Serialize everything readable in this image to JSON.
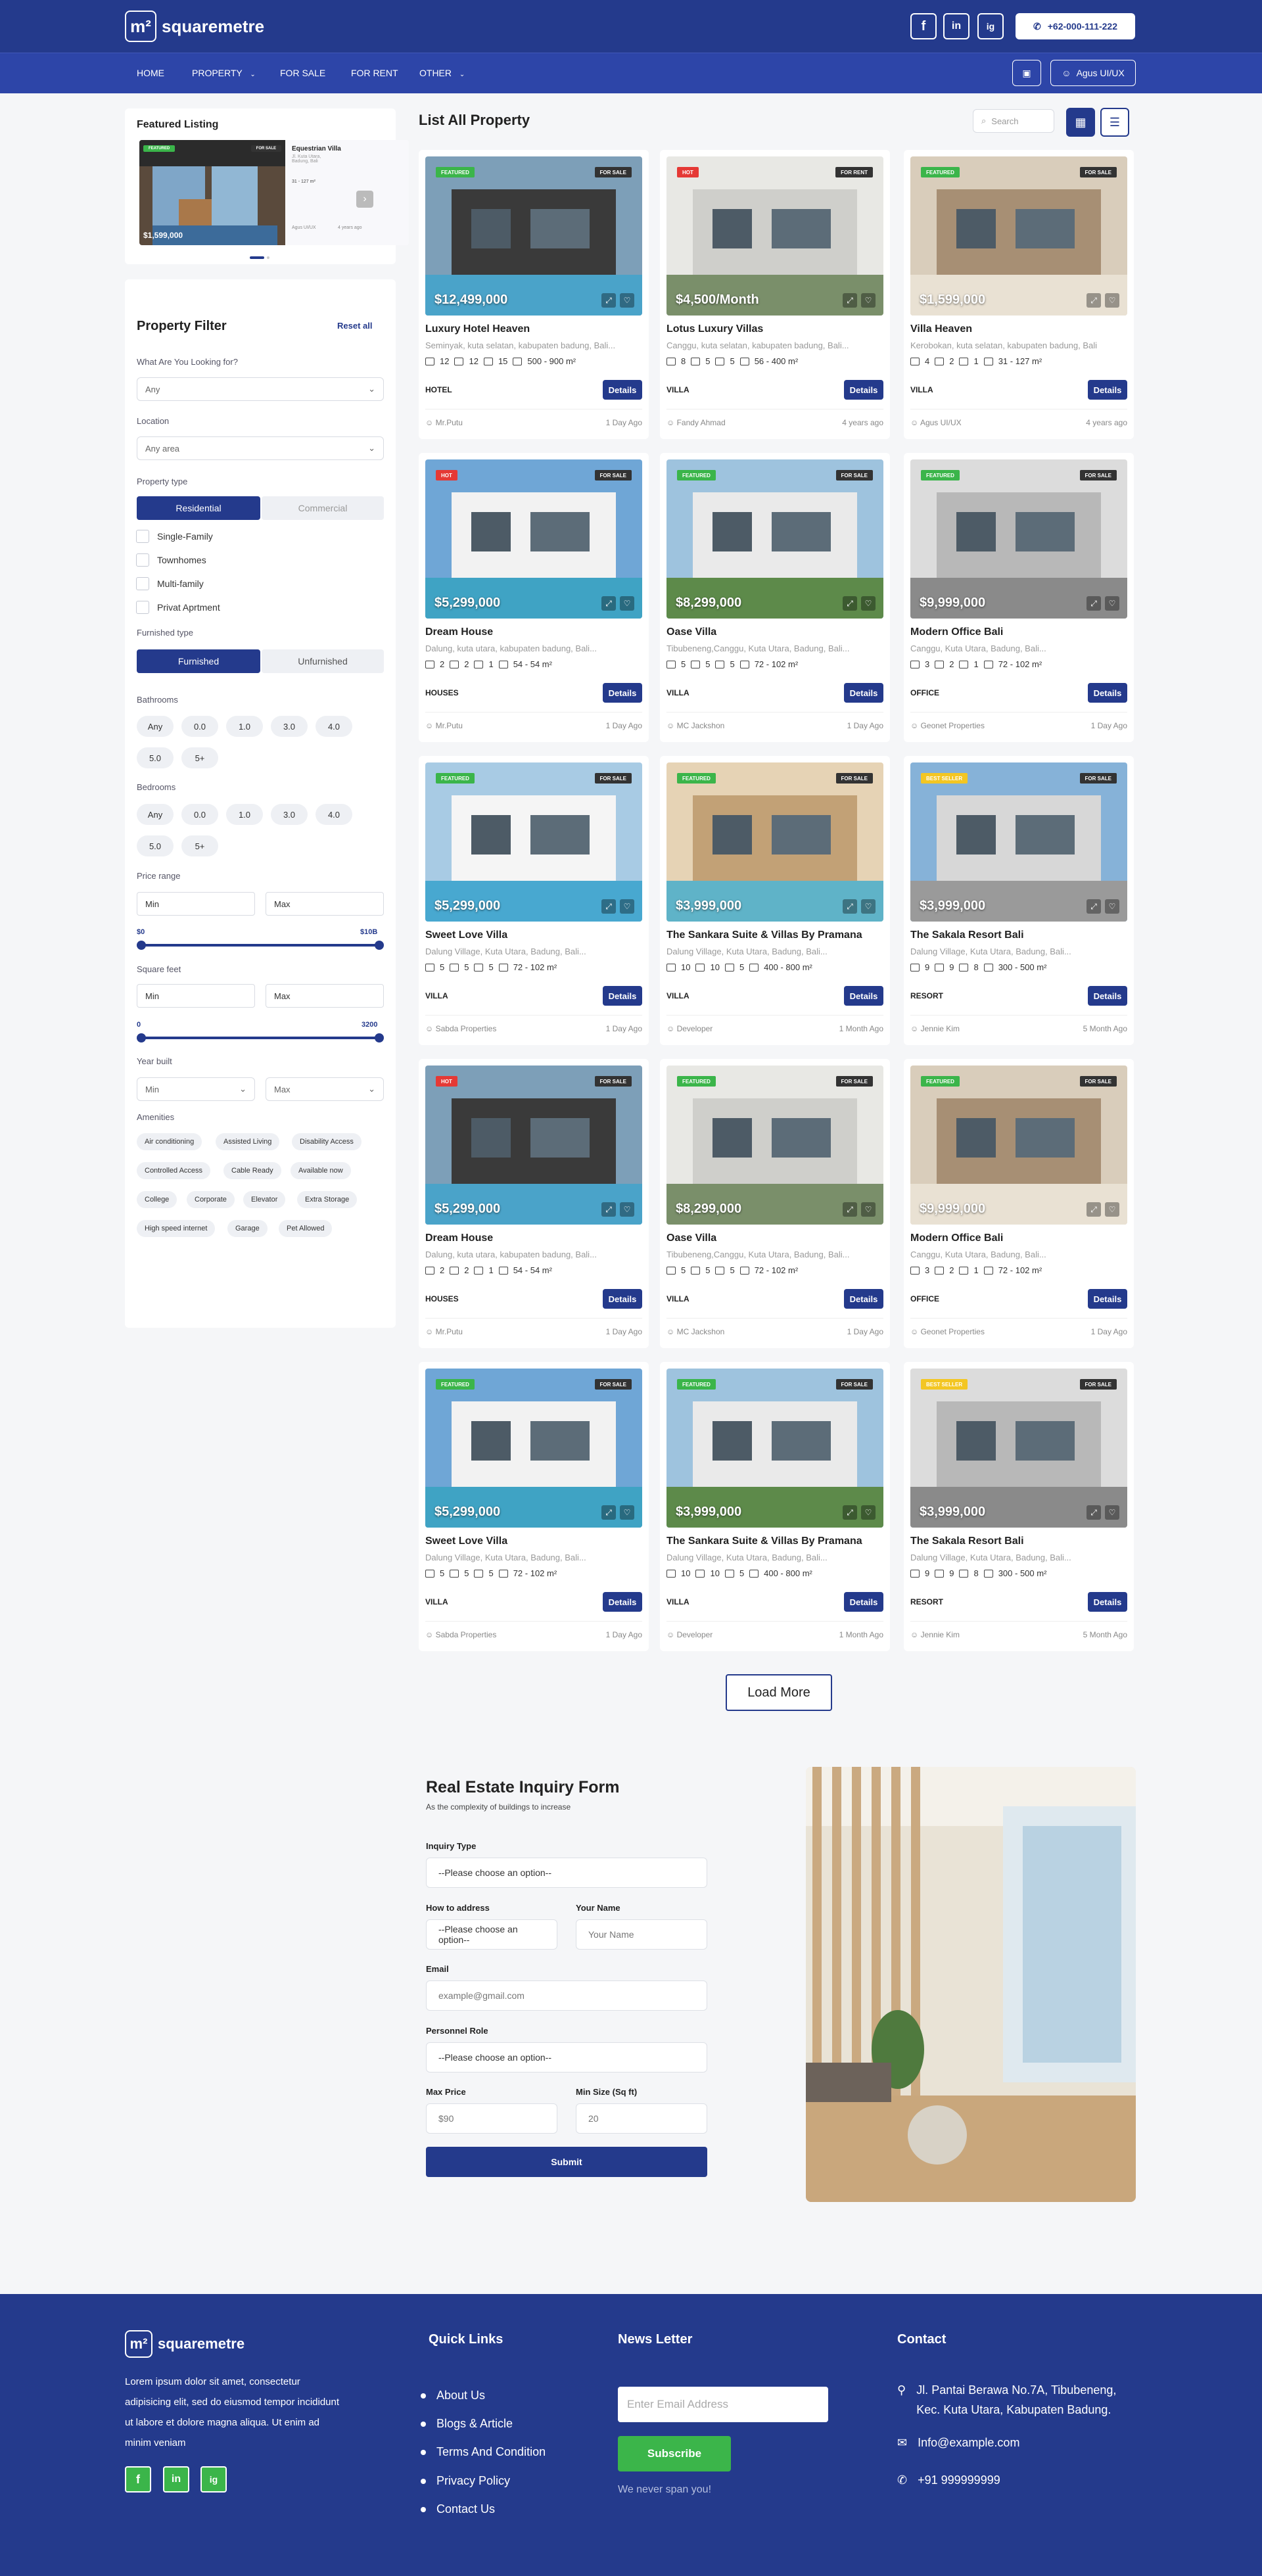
{
  "brand": {
    "name": "squaremetre",
    "mark": "m²"
  },
  "header": {
    "social": [
      "f",
      "in",
      "ig"
    ],
    "phone": "+62-000-111-222"
  },
  "nav": {
    "items": [
      "HOME",
      "PROPERTY",
      "FOR SALE",
      "FOR RENT",
      "OTHER"
    ],
    "user": "Agus UI/UX"
  },
  "featured": {
    "title": "Featured Listing",
    "name": "Equestrian Villa",
    "addr": "Jl. Kuta Utara, Badung, Bali",
    "price": "$1,599,000",
    "size": "31 - 127 m²",
    "agent": "Agus UI/UX",
    "time": "4 years ago",
    "badge": "FEATURED",
    "status": "FOR SALE"
  },
  "filter": {
    "title": "Property Filter",
    "reset": "Reset all",
    "looking_label": "What Are You Looking for?",
    "looking_value": "Any",
    "location_label": "Location",
    "location_value": "Any area",
    "ptype_label": "Property type",
    "ptype_options": [
      "Residential",
      "Commercial"
    ],
    "checks": [
      "Single-Family",
      "Townhomes",
      "Multi-family",
      "Privat Aprtment"
    ],
    "furnished_label": "Furnished type",
    "furnished_options": [
      "Furnished",
      "Unfurnished"
    ],
    "bathrooms_label": "Bathrooms",
    "bedrooms_label": "Bedrooms",
    "counts": [
      "Any",
      "0.0",
      "1.0",
      "3.0",
      "4.0",
      "5.0",
      "5+"
    ],
    "price_label": "Price range",
    "price_min": "Min",
    "price_max": "Max",
    "price_lo": "$0",
    "price_hi": "$10B",
    "sqft_label": "Square feet",
    "sqft_lo": "0",
    "sqft_hi": "3200",
    "year_label": "Year built",
    "year_min": "Min",
    "year_max": "Max",
    "amenities_label": "Amenities",
    "amenities": [
      "Air conditioning",
      "Assisted Living",
      "Disability Access",
      "Controlled Access",
      "Cable Ready",
      "Available now",
      "College",
      "Corporate",
      "Elevator",
      "Extra Storage",
      "High speed internet",
      "Garage",
      "Pet Allowed"
    ]
  },
  "listing": {
    "title": "List All Property",
    "search_placeholder": "Search",
    "load_more": "Load More",
    "details_label": "Details",
    "properties": [
      {
        "name": "Luxury Hotel Heaven",
        "addr": "Seminyak, kuta selatan, kabupaten badung, Bali...",
        "price": "$12,499,000",
        "badge": "FEATURED",
        "status": "FOR SALE",
        "type": "HOTEL",
        "f1": "12",
        "f2": "12",
        "f3": "15",
        "size": "500 - 900 m²",
        "agent": "Mr.Putu",
        "time": "1 Day Ago",
        "color": "#3bb54a"
      },
      {
        "name": "Lotus Luxury Villas",
        "addr": "Canggu, kuta selatan, kabupaten badung, Bali...",
        "price": "$4,500/Month",
        "badge": "HOT",
        "status": "FOR RENT",
        "type": "VILLA",
        "f1": "8",
        "f2": "5",
        "f3": "5",
        "size": "56 - 400 m²",
        "agent": "Fandy Ahmad",
        "time": "4 years ago",
        "color": "#e53935"
      },
      {
        "name": "Villa Heaven",
        "addr": "Kerobokan, kuta selatan, kabupaten badung, Bali",
        "price": "$1,599,000",
        "badge": "FEATURED",
        "status": "FOR SALE",
        "type": "VILLA",
        "f1": "4",
        "f2": "2",
        "f3": "1",
        "size": "31 - 127 m²",
        "agent": "Agus UI/UX",
        "time": "4 years ago",
        "color": "#3bb54a"
      },
      {
        "name": "Dream House",
        "addr": "Dalung, kuta utara, kabupaten badung, Bali...",
        "price": "$5,299,000",
        "badge": "HOT",
        "status": "FOR SALE",
        "type": "HOUSES",
        "f1": "2",
        "f2": "2",
        "f3": "1",
        "size": "54 - 54 m²",
        "agent": "Mr.Putu",
        "time": "1 Day Ago",
        "color": "#e53935"
      },
      {
        "name": "Oase Villa",
        "addr": "Tibubeneng,Canggu, Kuta Utara, Badung, Bali...",
        "price": "$8,299,000",
        "badge": "FEATURED",
        "status": "FOR SALE",
        "type": "VILLA",
        "f1": "5",
        "f2": "5",
        "f3": "5",
        "size": "72 - 102 m²",
        "agent": "MC Jackshon",
        "time": "1 Day Ago",
        "color": "#3bb54a"
      },
      {
        "name": "Modern Office Bali",
        "addr": "Canggu, Kuta Utara, Badung, Bali...",
        "price": "$9,999,000",
        "badge": "FEATURED",
        "status": "FOR SALE",
        "type": "OFFICE",
        "f1": "3",
        "f2": "2",
        "f3": "1",
        "size": "72 - 102 m²",
        "agent": "Geonet Properties",
        "time": "1 Day Ago",
        "color": "#3bb54a"
      },
      {
        "name": "Sweet Love Villa",
        "addr": "Dalung Village, Kuta Utara, Badung, Bali...",
        "price": "$5,299,000",
        "badge": "FEATURED",
        "status": "FOR SALE",
        "type": "VILLA",
        "f1": "5",
        "f2": "5",
        "f3": "5",
        "size": "72 - 102 m²",
        "agent": "Sabda Properties",
        "time": "1 Day Ago",
        "color": "#3bb54a"
      },
      {
        "name": "The Sankara Suite & Villas By Pramana",
        "addr": "Dalung Village, Kuta Utara, Badung, Bali...",
        "price": "$3,999,000",
        "badge": "FEATURED",
        "status": "FOR SALE",
        "type": "VILLA",
        "f1": "10",
        "f2": "10",
        "f3": "5",
        "size": "400 - 800 m²",
        "agent": "Developer",
        "time": "1 Month Ago",
        "color": "#3bb54a"
      },
      {
        "name": "The Sakala Resort Bali",
        "addr": "Dalung Village, Kuta Utara, Badung, Bali...",
        "price": "$3,999,000",
        "badge": "BEST SELLER",
        "status": "FOR SALE",
        "type": "RESORT",
        "f1": "9",
        "f2": "9",
        "f3": "8",
        "size": "300 - 500 m²",
        "agent": "Jennie Kim",
        "time": "5 Month Ago",
        "color": "#f3c623"
      },
      {
        "name": "Dream House",
        "addr": "Dalung, kuta utara, kabupaten badung, Bali...",
        "price": "$5,299,000",
        "badge": "HOT",
        "status": "FOR SALE",
        "type": "HOUSES",
        "f1": "2",
        "f2": "2",
        "f3": "1",
        "size": "54 - 54 m²",
        "agent": "Mr.Putu",
        "time": "1 Day Ago",
        "color": "#e53935"
      },
      {
        "name": "Oase Villa",
        "addr": "Tibubeneng,Canggu, Kuta Utara, Badung, Bali...",
        "price": "$8,299,000",
        "badge": "FEATURED",
        "status": "FOR SALE",
        "type": "VILLA",
        "f1": "5",
        "f2": "5",
        "f3": "5",
        "size": "72 - 102 m²",
        "agent": "MC Jackshon",
        "time": "1 Day Ago",
        "color": "#3bb54a"
      },
      {
        "name": "Modern Office Bali",
        "addr": "Canggu, Kuta Utara, Badung, Bali...",
        "price": "$9,999,000",
        "badge": "FEATURED",
        "status": "FOR SALE",
        "type": "OFFICE",
        "f1": "3",
        "f2": "2",
        "f3": "1",
        "size": "72 - 102 m²",
        "agent": "Geonet Properties",
        "time": "1 Day Ago",
        "color": "#3bb54a"
      },
      {
        "name": "Sweet Love Villa",
        "addr": "Dalung Village, Kuta Utara, Badung, Bali...",
        "price": "$5,299,000",
        "badge": "FEATURED",
        "status": "FOR SALE",
        "type": "VILLA",
        "f1": "5",
        "f2": "5",
        "f3": "5",
        "size": "72 - 102 m²",
        "agent": "Sabda Properties",
        "time": "1 Day Ago",
        "color": "#3bb54a"
      },
      {
        "name": "The Sankara Suite & Villas By Pramana",
        "addr": "Dalung Village, Kuta Utara, Badung, Bali...",
        "price": "$3,999,000",
        "badge": "FEATURED",
        "status": "FOR SALE",
        "type": "VILLA",
        "f1": "10",
        "f2": "10",
        "f3": "5",
        "size": "400 - 800 m²",
        "agent": "Developer",
        "time": "1 Month Ago",
        "color": "#3bb54a"
      },
      {
        "name": "The Sakala Resort Bali",
        "addr": "Dalung Village, Kuta Utara, Badung, Bali...",
        "price": "$3,999,000",
        "badge": "BEST SELLER",
        "status": "FOR SALE",
        "type": "RESORT",
        "f1": "9",
        "f2": "9",
        "f3": "8",
        "size": "300 - 500 m²",
        "agent": "Jennie Kim",
        "time": "5 Month Ago",
        "color": "#f3c623"
      }
    ]
  },
  "inquiry": {
    "title": "Real Estate Inquiry Form",
    "subtitle": "As the complexity of buildings to increase",
    "type_label": "Inquiry Type",
    "choose": "--Please choose an option--",
    "address_label": "How to address",
    "name_label": "Your Name",
    "name_placeholder": "Your Name",
    "email_label": "Email",
    "email_placeholder": "example@gmail.com",
    "role_label": "Personnel Role",
    "maxprice_label": "Max Price",
    "maxprice_value": "$90",
    "minsize_label": "Min Size (Sq ft)",
    "minsize_value": "20",
    "submit": "Submit"
  },
  "footer": {
    "about": "Lorem ipsum dolor sit amet, consectetur adipisicing elit, sed do eiusmod tempor incididunt ut labore et dolore magna aliqua. Ut enim ad minim veniam",
    "quick_title": "Quick Links",
    "links": [
      "About Us",
      "Blogs & Article",
      "Terms And Condition",
      "Privacy Policy",
      "Contact Us"
    ],
    "news_title": "News Letter",
    "email_placeholder": "Enter Email Address",
    "subscribe": "Subscribe",
    "spam": "We never span you!",
    "contact_title": "Contact",
    "address": "Jl. Pantai Berawa No.7A, Tibubeneng, Kec. Kuta Utara, Kabupaten Badung.",
    "email": "Info@example.com",
    "phone": "+91 999999999"
  },
  "colors": {
    "primary": "#243a8c",
    "green": "#3bb54a",
    "hot": "#e53935",
    "best": "#f3c623"
  }
}
